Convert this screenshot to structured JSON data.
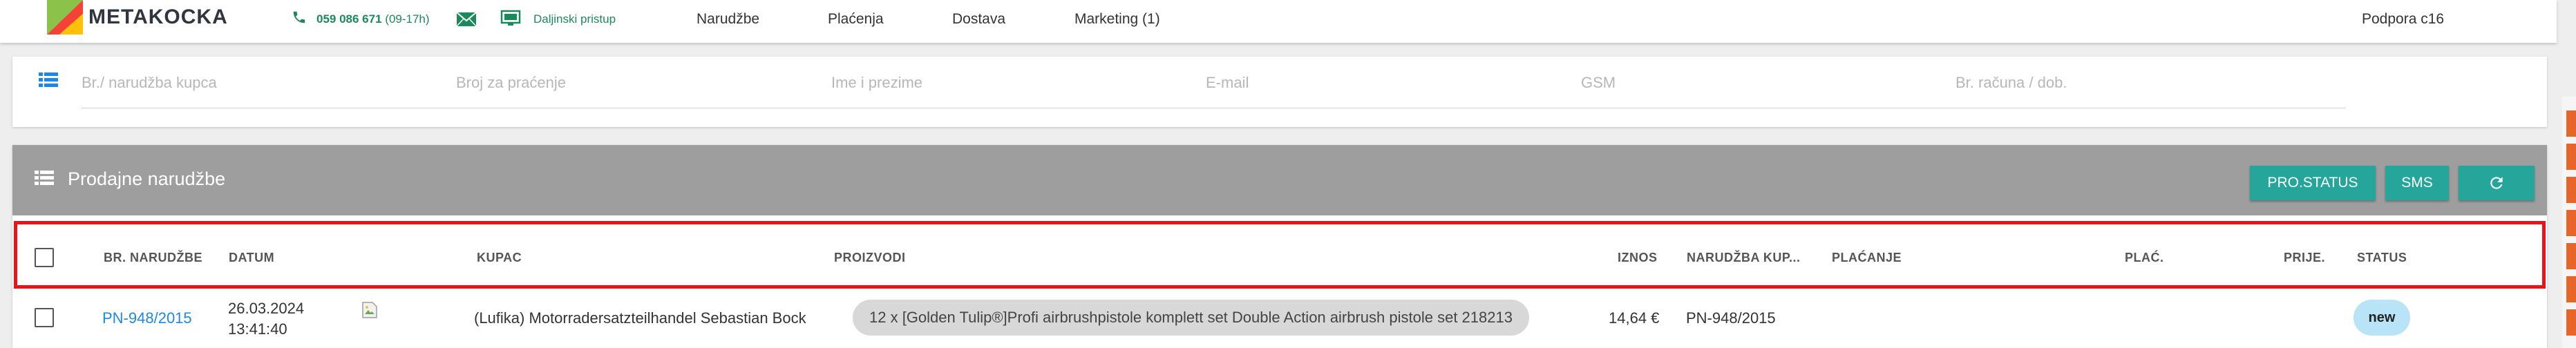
{
  "header": {
    "brand": "METAKOCKA",
    "phone": "059 086 671",
    "phone_hours": "(09-17h)",
    "remote_access": "Daljinski pristup",
    "nav": [
      "Narudžbe",
      "Plaćenja",
      "Dostava",
      "Marketing (1)"
    ],
    "support": "Podpora c16"
  },
  "search": {
    "placeholders": [
      "Br./ narudžba kupca",
      "Broj za praćenje",
      "Ime i prezime",
      "E-mail",
      "GSM",
      "Br. računa / dob."
    ]
  },
  "orders": {
    "title": "Prodajne narudžbe",
    "buttons": {
      "pro_status": "PRO.STATUS",
      "sms": "SMS"
    },
    "columns": {
      "number": "BR. NARUDŽBE",
      "date": "DATUM",
      "customer": "KUPAC",
      "products": "PROIZVODI",
      "amount": "IZNOS",
      "customer_order": "NARUDŽBA KUP...",
      "payment": "PLAĆANJE",
      "paid": "PLAĆ.",
      "received": "PRIJE.",
      "status": "STATUS"
    },
    "rows": [
      {
        "number": "PN-948/2015",
        "date": "26.03.2024",
        "time": "13:41:40",
        "customer": "(Lufika) Motorradersatzteilhandel Sebastian Bock",
        "products": "12 x [Golden Tulip®]Profi airbrushpistole komplett set Double Action airbrush pistole set 218213",
        "amount": "14,64 €",
        "customer_order": "PN-948/2015",
        "status": "new"
      }
    ]
  },
  "colors": {
    "accent": "#26a69a",
    "panel_header": "#9e9e9e",
    "link": "#1e88e5",
    "highlight": "#e8141a",
    "status_new": "#b9e3f7"
  },
  "icons": [
    "phone-icon",
    "mail-icon",
    "monitor-icon",
    "list-icon",
    "refresh-icon",
    "broken-image-icon"
  ]
}
